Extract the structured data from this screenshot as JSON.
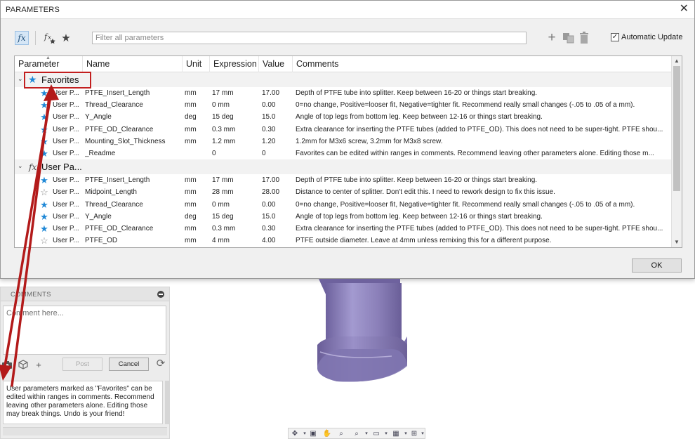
{
  "dialog": {
    "title": "PARAMETERS",
    "close_glyph": "✕",
    "filter_placeholder": "Filter all parameters",
    "auto_update_label": "Automatic Update",
    "auto_update_checked": true,
    "ok_label": "OK"
  },
  "toolbar_icons": [
    "fx-icon",
    "fx-star-icon",
    "star-icon",
    "plus-icon",
    "copy-icon",
    "trash-icon"
  ],
  "columns": [
    "Parameter",
    "Name",
    "Unit",
    "Expression",
    "Value",
    "Comments"
  ],
  "groups": [
    {
      "label": "Favorites",
      "icon": "star-icon",
      "rows": [
        {
          "favorite": true,
          "parameter": "User P...",
          "name": "PTFE_Insert_Length",
          "unit": "mm",
          "expression": "17 mm",
          "value": "17.00",
          "comment": "Depth of PTFE tube into splitter. Keep between 16-20 or things start breaking."
        },
        {
          "favorite": true,
          "parameter": "User P...",
          "name": "Thread_Clearance",
          "unit": "mm",
          "expression": "0 mm",
          "value": "0.00",
          "comment": "0=no change, Positive=looser fit, Negative=tighter fit. Recommend really small changes (-.05 to .05 of a mm)."
        },
        {
          "favorite": true,
          "parameter": "User P...",
          "name": "Y_Angle",
          "unit": "deg",
          "expression": "15 deg",
          "value": "15.0",
          "comment": "Angle of top legs from bottom leg. Keep between 12-16 or things start breaking."
        },
        {
          "favorite": true,
          "parameter": "User P...",
          "name": "PTFE_OD_Clearance",
          "unit": "mm",
          "expression": "0.3 mm",
          "value": "0.30",
          "comment": "Extra clearance for inserting the PTFE tubes (added to PTFE_OD). This does not need to be super-tight. PTFE shou..."
        },
        {
          "favorite": true,
          "parameter": "User P...",
          "name": "Mounting_Slot_Thickness",
          "unit": "mm",
          "expression": "1.2 mm",
          "value": "1.20",
          "comment": "1.2mm for M3x6 screw, 3.2mm for M3x8 screw."
        },
        {
          "favorite": true,
          "parameter": "User P...",
          "name": "_Readme",
          "unit": "",
          "expression": "0",
          "value": "0",
          "comment": "Favorites can be edited within ranges in comments. Recommend leaving other parameters alone. Editing those m..."
        }
      ]
    },
    {
      "label": "User Pa...",
      "icon": "fx-icon",
      "rows": [
        {
          "favorite": true,
          "parameter": "User P...",
          "name": "PTFE_Insert_Length",
          "unit": "mm",
          "expression": "17 mm",
          "value": "17.00",
          "comment": "Depth of PTFE tube into splitter. Keep between 16-20 or things start breaking."
        },
        {
          "favorite": false,
          "parameter": "User P...",
          "name": "Midpoint_Length",
          "unit": "mm",
          "expression": "28 mm",
          "value": "28.00",
          "comment": "Distance to center of splitter. Don't edit this. I need to rework design to fix this issue."
        },
        {
          "favorite": true,
          "parameter": "User P...",
          "name": "Thread_Clearance",
          "unit": "mm",
          "expression": "0 mm",
          "value": "0.00",
          "comment": "0=no change, Positive=looser fit, Negative=tighter fit. Recommend really small changes (-.05 to .05 of a mm)."
        },
        {
          "favorite": true,
          "parameter": "User P...",
          "name": "Y_Angle",
          "unit": "deg",
          "expression": "15 deg",
          "value": "15.0",
          "comment": "Angle of top legs from bottom leg. Keep between 12-16 or things start breaking."
        },
        {
          "favorite": true,
          "parameter": "User P...",
          "name": "PTFE_OD_Clearance",
          "unit": "mm",
          "expression": "0.3 mm",
          "value": "0.30",
          "comment": "Extra clearance for inserting the PTFE tubes (added to PTFE_OD). This does not need to be super-tight. PTFE shou..."
        },
        {
          "favorite": false,
          "parameter": "User P...",
          "name": "PTFE_OD",
          "unit": "mm",
          "expression": "4 mm",
          "value": "4.00",
          "comment": "PTFE outside diameter. Leave at 4mm unless remixing this for a different purpose."
        }
      ]
    }
  ],
  "comments_panel": {
    "header": "COMMENTS",
    "placeholder": "Comment here...",
    "post_label": "Post",
    "cancel_label": "Cancel",
    "note": "User parameters marked as \"Favorites\" can be edited within ranges in comments. Recommend leaving other parameters alone. Editing those may break things. Undo is your friend!"
  },
  "colors": {
    "favorite_star": "#1f88d6",
    "annotation_red": "#b31a1a",
    "model_purple": "#8a7fb8"
  }
}
